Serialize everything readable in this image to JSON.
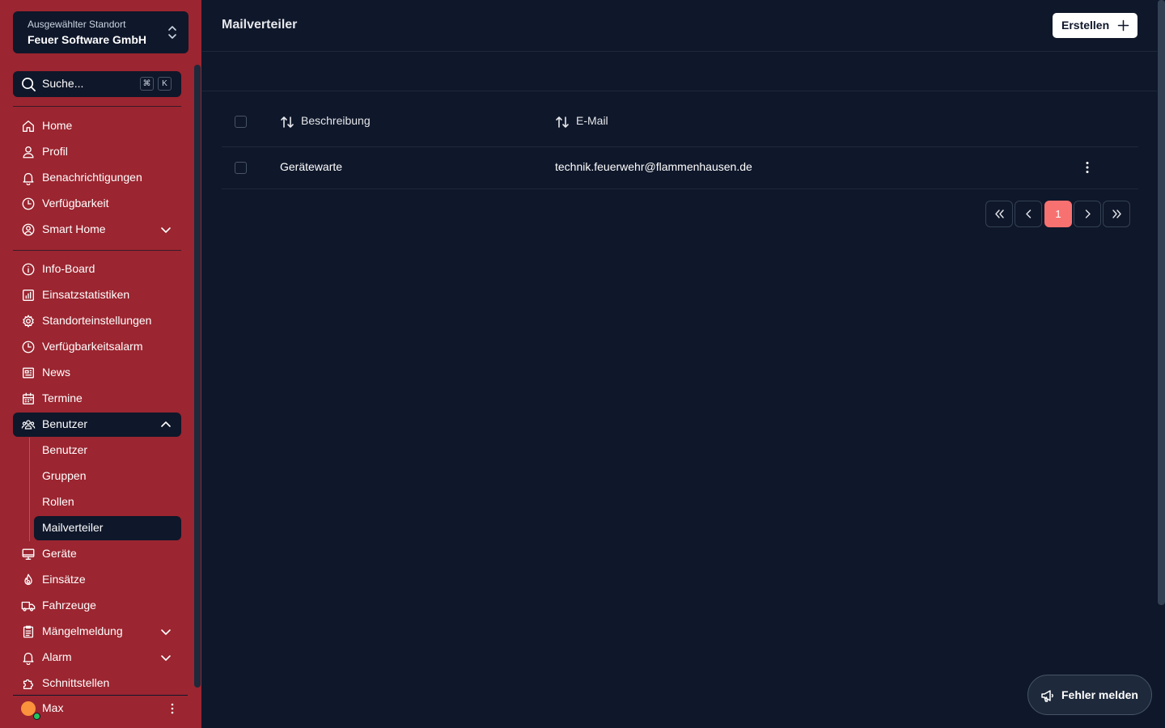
{
  "sidebar": {
    "location_label": "Ausgewählter Standort",
    "location_value": "Feuer Software GmbH",
    "search_placeholder": "Suche...",
    "search_kbd_cmd": "⌘",
    "search_kbd_key": "K",
    "items": [
      {
        "label": "Home",
        "icon": "home-icon"
      },
      {
        "label": "Profil",
        "icon": "user-icon"
      },
      {
        "label": "Benachrichtigungen",
        "icon": "bell-icon"
      },
      {
        "label": "Verfügbarkeit",
        "icon": "clock-icon"
      },
      {
        "label": "Smart Home",
        "icon": "user-circle-icon"
      },
      {
        "label": "Info-Board",
        "icon": "info-icon"
      },
      {
        "label": "Einsatzstatistiken",
        "icon": "chart-icon"
      },
      {
        "label": "Standorteinstellungen",
        "icon": "gear-icon"
      },
      {
        "label": "Verfügbarkeitsalarm",
        "icon": "clock-icon"
      },
      {
        "label": "News",
        "icon": "newspaper-icon"
      },
      {
        "label": "Termine",
        "icon": "calendar-icon"
      },
      {
        "label": "Benutzer",
        "icon": "users-icon"
      },
      {
        "label": "Geräte",
        "icon": "monitor-icon"
      },
      {
        "label": "Einsätze",
        "icon": "fire-icon"
      },
      {
        "label": "Fahrzeuge",
        "icon": "truck-icon"
      },
      {
        "label": "Mängelmeldung",
        "icon": "clipboard-icon"
      },
      {
        "label": "Alarm",
        "icon": "bell-icon"
      },
      {
        "label": "Schnittstellen",
        "icon": "puzzle-icon"
      }
    ],
    "sub_items": [
      "Benutzer",
      "Gruppen",
      "Rollen",
      "Mailverteiler"
    ],
    "user_name": "Max"
  },
  "main": {
    "title": "Mailverteiler",
    "create_label": "Erstellen",
    "columns": [
      "Beschreibung",
      "E-Mail"
    ],
    "rows": [
      {
        "description": "Gerätewarte",
        "email": "technik.feuerwehr@flammenhausen.de"
      }
    ],
    "current_page": "1",
    "report_label": "Fehler melden"
  },
  "colors": {
    "sidebar_bg": "#9b2530",
    "main_bg": "#0f172a",
    "accent": "#f87171"
  }
}
